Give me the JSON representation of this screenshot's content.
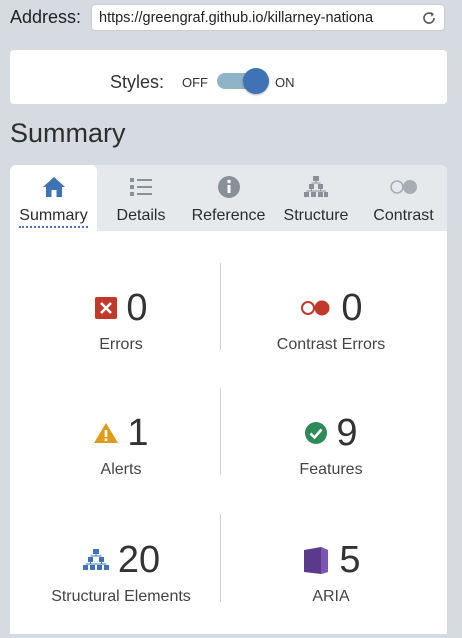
{
  "address": {
    "label": "Address:",
    "url": "https://greengraf.github.io/killarney-nationa"
  },
  "styles": {
    "label": "Styles:",
    "off": "OFF",
    "on": "ON",
    "enabled": true
  },
  "page": {
    "title": "Summary"
  },
  "tabs": [
    {
      "label": "Summary",
      "icon": "home-icon",
      "active": true
    },
    {
      "label": "Details",
      "icon": "list-icon",
      "active": false
    },
    {
      "label": "Reference",
      "icon": "info-icon",
      "active": false
    },
    {
      "label": "Structure",
      "icon": "hierarchy-icon",
      "active": false
    },
    {
      "label": "Contrast",
      "icon": "contrast-icon",
      "active": false
    }
  ],
  "summary": {
    "errors": {
      "count": "0",
      "label": "Errors",
      "icon": "error-icon",
      "color": "#c0392b"
    },
    "contrast_errors": {
      "count": "0",
      "label": "Contrast Errors",
      "icon": "contrast-error-icon",
      "color": "#c0392b"
    },
    "alerts": {
      "count": "1",
      "label": "Alerts",
      "icon": "alert-icon",
      "color": "#e09b1b"
    },
    "features": {
      "count": "9",
      "label": "Features",
      "icon": "feature-icon",
      "color": "#2f8a5a"
    },
    "structural": {
      "count": "20",
      "label": "Structural Elements",
      "icon": "structure-icon",
      "color": "#3f73b6"
    },
    "aria": {
      "count": "5",
      "label": "ARIA",
      "icon": "aria-icon",
      "color": "#5b3a8c"
    }
  },
  "colors": {
    "accent": "#3f73b6",
    "background": "#d6dbe1",
    "tab_bar": "#e6e9ec"
  }
}
